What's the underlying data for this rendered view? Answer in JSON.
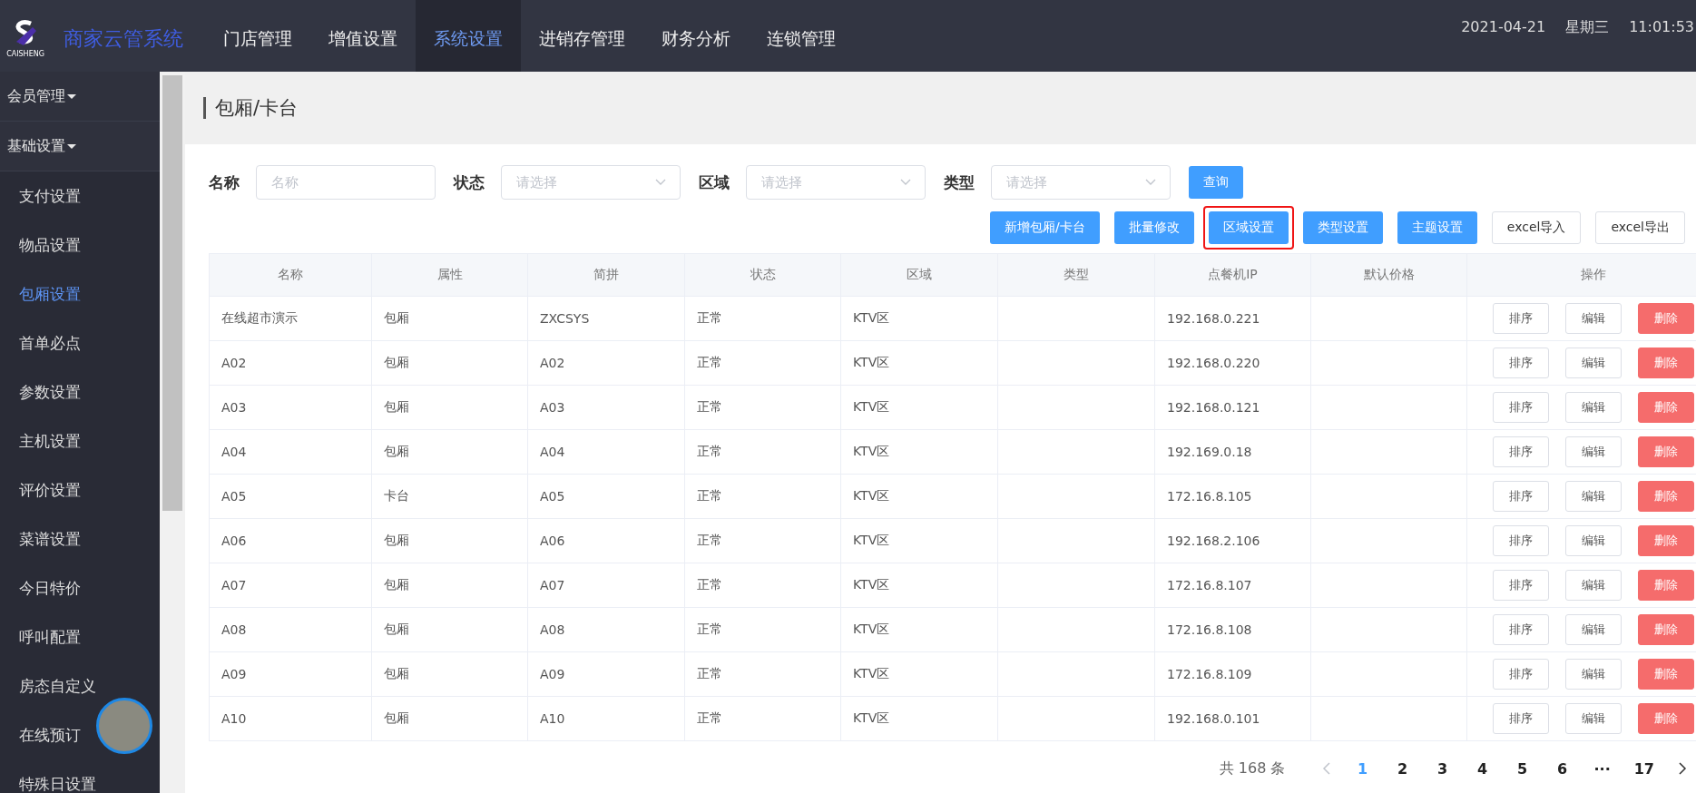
{
  "header": {
    "logo_text": "CAISHENG",
    "app_name": "商家云管系统",
    "nav": [
      {
        "label": "门店管理",
        "selected": false
      },
      {
        "label": "增值设置",
        "selected": false
      },
      {
        "label": "系统设置",
        "selected": true
      },
      {
        "label": "进销存管理",
        "selected": false
      },
      {
        "label": "财务分析",
        "selected": false
      },
      {
        "label": "连锁管理",
        "selected": false
      }
    ],
    "date": "2021-04-21",
    "weekday": "星期三",
    "time": "11:01:53"
  },
  "sidebar": {
    "groups": [
      {
        "label": "会员管理"
      },
      {
        "label": "基础设置",
        "children": [
          {
            "label": "支付设置",
            "selected": false
          },
          {
            "label": "物品设置",
            "selected": false
          },
          {
            "label": "包厢设置",
            "selected": true
          },
          {
            "label": "首单必点",
            "selected": false
          },
          {
            "label": "参数设置",
            "selected": false
          },
          {
            "label": "主机设置",
            "selected": false
          },
          {
            "label": "评价设置",
            "selected": false
          },
          {
            "label": "菜谱设置",
            "selected": false
          },
          {
            "label": "今日特价",
            "selected": false
          },
          {
            "label": "呼叫配置",
            "selected": false
          },
          {
            "label": "房态自定义",
            "selected": false
          },
          {
            "label": "在线预订",
            "selected": false
          },
          {
            "label": "特殊日设置",
            "selected": false
          }
        ]
      }
    ]
  },
  "page_title": "包厢/卡台",
  "filters": [
    {
      "label": "名称",
      "kind": "text",
      "placeholder": "名称"
    },
    {
      "label": "状态",
      "kind": "select",
      "placeholder": "请选择"
    },
    {
      "label": "区域",
      "kind": "select",
      "placeholder": "请选择"
    },
    {
      "label": "类型",
      "kind": "select",
      "placeholder": "请选择"
    }
  ],
  "query_button": "查询",
  "actions": [
    {
      "label": "新增包厢/卡台",
      "kind": "primary",
      "highlighted": false
    },
    {
      "label": "批量修改",
      "kind": "primary",
      "highlighted": false
    },
    {
      "label": "区域设置",
      "kind": "primary",
      "highlighted": true
    },
    {
      "label": "类型设置",
      "kind": "primary",
      "highlighted": false
    },
    {
      "label": "主题设置",
      "kind": "primary",
      "highlighted": false
    },
    {
      "label": "excel导入",
      "kind": "plain",
      "highlighted": false
    },
    {
      "label": "excel导出",
      "kind": "plain",
      "highlighted": false
    }
  ],
  "table": {
    "columns": [
      "名称",
      "属性",
      "简拼",
      "状态",
      "区域",
      "类型",
      "点餐机IP",
      "默认价格",
      "操作"
    ],
    "rows": [
      {
        "cells": [
          "在线超市演示",
          "包厢",
          "ZXCSYS",
          "正常",
          "KTV区",
          "",
          "192.168.0.221",
          ""
        ],
        "actions": [
          "排序",
          "编辑",
          "删除"
        ]
      },
      {
        "cells": [
          "A02",
          "包厢",
          "A02",
          "正常",
          "KTV区",
          "",
          "192.168.0.220",
          ""
        ],
        "actions": [
          "排序",
          "编辑",
          "删除"
        ]
      },
      {
        "cells": [
          "A03",
          "包厢",
          "A03",
          "正常",
          "KTV区",
          "",
          "192.168.0.121",
          ""
        ],
        "actions": [
          "排序",
          "编辑",
          "删除"
        ]
      },
      {
        "cells": [
          "A04",
          "包厢",
          "A04",
          "正常",
          "KTV区",
          "",
          "192.169.0.18",
          ""
        ],
        "actions": [
          "排序",
          "编辑",
          "删除"
        ]
      },
      {
        "cells": [
          "A05",
          "卡台",
          "A05",
          "正常",
          "KTV区",
          "",
          "172.16.8.105",
          ""
        ],
        "actions": [
          "排序",
          "编辑",
          "删除"
        ]
      },
      {
        "cells": [
          "A06",
          "包厢",
          "A06",
          "正常",
          "KTV区",
          "",
          "192.168.2.106",
          ""
        ],
        "actions": [
          "排序",
          "编辑",
          "删除"
        ]
      },
      {
        "cells": [
          "A07",
          "包厢",
          "A07",
          "正常",
          "KTV区",
          "",
          "172.16.8.107",
          ""
        ],
        "actions": [
          "排序",
          "编辑",
          "删除"
        ]
      },
      {
        "cells": [
          "A08",
          "包厢",
          "A08",
          "正常",
          "KTV区",
          "",
          "172.16.8.108",
          ""
        ],
        "actions": [
          "排序",
          "编辑",
          "删除"
        ]
      },
      {
        "cells": [
          "A09",
          "包厢",
          "A09",
          "正常",
          "KTV区",
          "",
          "172.16.8.109",
          ""
        ],
        "actions": [
          "排序",
          "编辑",
          "删除"
        ]
      },
      {
        "cells": [
          "A10",
          "包厢",
          "A10",
          "正常",
          "KTV区",
          "",
          "192.168.0.101",
          ""
        ],
        "actions": [
          "排序",
          "编辑",
          "删除"
        ]
      }
    ]
  },
  "pagination": {
    "total": "共 168 条",
    "prev_disabled": true,
    "pages": [
      {
        "label": "1",
        "selected": true
      },
      {
        "label": "2",
        "selected": false
      },
      {
        "label": "3",
        "selected": false
      },
      {
        "label": "4",
        "selected": false
      },
      {
        "label": "5",
        "selected": false
      },
      {
        "label": "6",
        "selected": false
      },
      {
        "label": "···",
        "selected": false
      },
      {
        "label": "17",
        "selected": false
      }
    ]
  }
}
